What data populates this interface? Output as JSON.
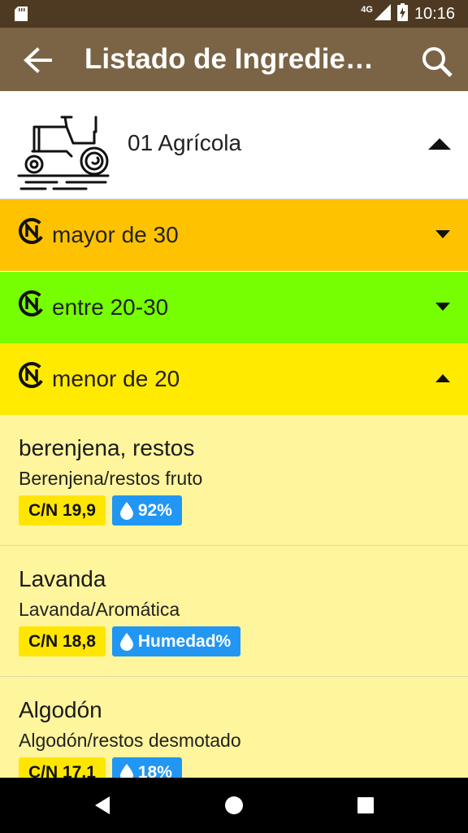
{
  "status_bar": {
    "network": "4G",
    "time": "10:16"
  },
  "app_bar": {
    "title": "Listado de Ingredie…"
  },
  "category": {
    "label": "01 Agrícola"
  },
  "groups": [
    {
      "label": "mayor de 30",
      "color": "#ffc200",
      "expanded": false
    },
    {
      "label": "entre 20-30",
      "color": "#76ff03",
      "expanded": false
    },
    {
      "label": "menor de 20",
      "color": "#ffea00",
      "expanded": true
    }
  ],
  "items": [
    {
      "name": "berenjena, restos",
      "desc": "Berenjena/restos fruto",
      "cn": "C/N 19,9",
      "humidity": "92%"
    },
    {
      "name": "Lavanda",
      "desc": "Lavanda/Aromática",
      "cn": "C/N 18,8",
      "humidity": "Humedad%"
    },
    {
      "name": "Algodón",
      "desc": "Algodón/restos desmotado",
      "cn": "C/N 17,1",
      "humidity": "18%"
    }
  ],
  "colors": {
    "status_bar": "#4e3a22",
    "app_bar": "#7b6445",
    "list_bg": "#fff59d",
    "cn_badge": "#ffe600",
    "humidity_badge": "#2196f3"
  },
  "icons": [
    "back-arrow-icon",
    "search-icon",
    "tractor-icon",
    "cn-icon",
    "droplet-icon",
    "caret-up-icon",
    "caret-down-icon"
  ]
}
